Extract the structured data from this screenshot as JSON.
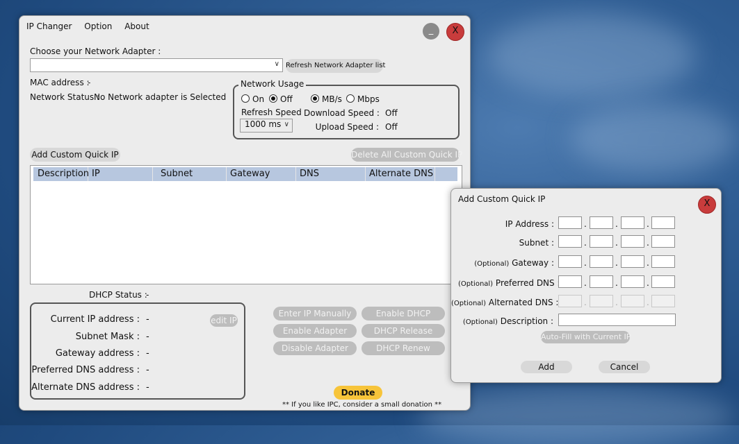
{
  "main_window": {
    "menu": [
      "IP Changer",
      "Option",
      "About"
    ],
    "minimize_label": "_",
    "close_label": "X",
    "choose_adapter_label": "Choose your Network Adapter :",
    "adapter_select_value": "",
    "refresh_button": "Refresh Network Adapter list",
    "mac_label": "MAC address :",
    "mac_value": "-",
    "network_status_label": "Network Status :",
    "network_status_value": "No Network adapter is Selected",
    "network_usage": {
      "title": "Network Usage",
      "on_label": "On",
      "off_label": "Off",
      "mbs_label": "MB/s",
      "mbps_label": "Mbps",
      "refresh_speed_label": "Refresh Speed",
      "refresh_speed_value": "1000 ms",
      "download_label": "Download Speed :",
      "download_value": "Off",
      "upload_label": "Upload Speed :",
      "upload_value": "Off"
    },
    "add_quick_ip_button": "Add Custom Quick IP",
    "delete_all_button": "Delete All Custom Quick IP",
    "table_headers": [
      "Description",
      "IP",
      "Subnet",
      "Gateway",
      "DNS",
      "Alternate DNS"
    ],
    "dhcp_status_label": "DHCP Status :",
    "dhcp_status_value": "-",
    "current_info": {
      "current_ip_label": "Current IP address :",
      "current_ip_value": "-",
      "subnet_label": "Subnet Mask :",
      "subnet_value": "-",
      "gateway_label": "Gateway address :",
      "gateway_value": "-",
      "pref_dns_label": "Preferred DNS address :",
      "pref_dns_value": "-",
      "alt_dns_label": "Alternate DNS address :",
      "alt_dns_value": "-",
      "edit_ip_button": "edit IP"
    },
    "actions": {
      "enter_ip_manually": "Enter IP Manually",
      "enable_dhcp": "Enable DHCP",
      "enable_adapter": "Enable Adapter",
      "dhcp_release": "DHCP Release",
      "disable_adapter": "Disable Adapter",
      "dhcp_renew": "DHCP Renew"
    },
    "donate_button": "Donate",
    "donate_note": "** If you like IPC, consider a small donation **"
  },
  "dialog": {
    "title": "Add Custom Quick IP",
    "close_label": "X",
    "ip_address_label": "IP Address :",
    "subnet_label": "Subnet :",
    "gateway_optional": "(Optional)",
    "gateway_label": "Gateway :",
    "pref_dns_optional": "(Optional)",
    "pref_dns_label": "Preferred DNS :",
    "alt_dns_optional": "(Optional)",
    "alt_dns_label": "Alternated DNS :",
    "desc_optional": "(Optional)",
    "desc_label": "Description :",
    "autofill_button": "Auto-Fill with Current IP",
    "add_button": "Add",
    "cancel_button": "Cancel"
  }
}
